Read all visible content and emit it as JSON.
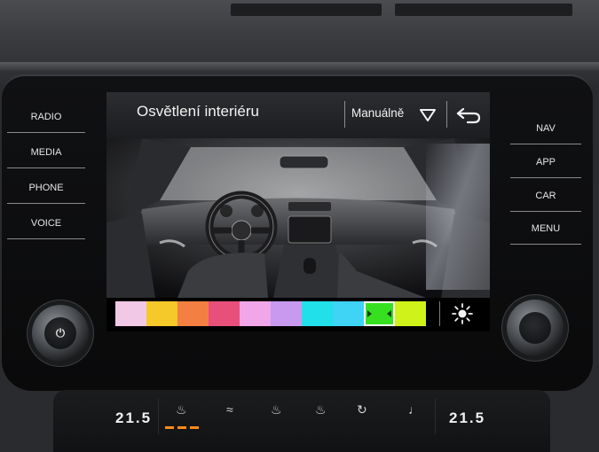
{
  "left_buttons": [
    "RADIO",
    "MEDIA",
    "PHONE",
    "VOICE"
  ],
  "right_buttons": [
    "NAV",
    "APP",
    "CAR",
    "MENU"
  ],
  "screen": {
    "title": "Osvětlení interiéru",
    "mode": "Manuálně",
    "dropdown_icon": "triangle-down-icon",
    "back_icon": "back-arrow-icon",
    "brightness_icon": "sun-icon"
  },
  "palette": {
    "colors": [
      "#f1c8e6",
      "#f6c92a",
      "#f47f43",
      "#e84f7a",
      "#f1a6ea",
      "#c79af0",
      "#22e0ea",
      "#3fd3f5",
      "#36e021",
      "#cff21a"
    ],
    "selected_index": 8
  },
  "climate": {
    "left_temp": "21.5",
    "right_temp": "21.5",
    "icons": [
      "seat-heat-icon",
      "seat-vent-icon",
      "steering-heat-icon",
      "seat-heat-right-icon",
      "car-recirculation-icon",
      "seat-icon"
    ]
  }
}
